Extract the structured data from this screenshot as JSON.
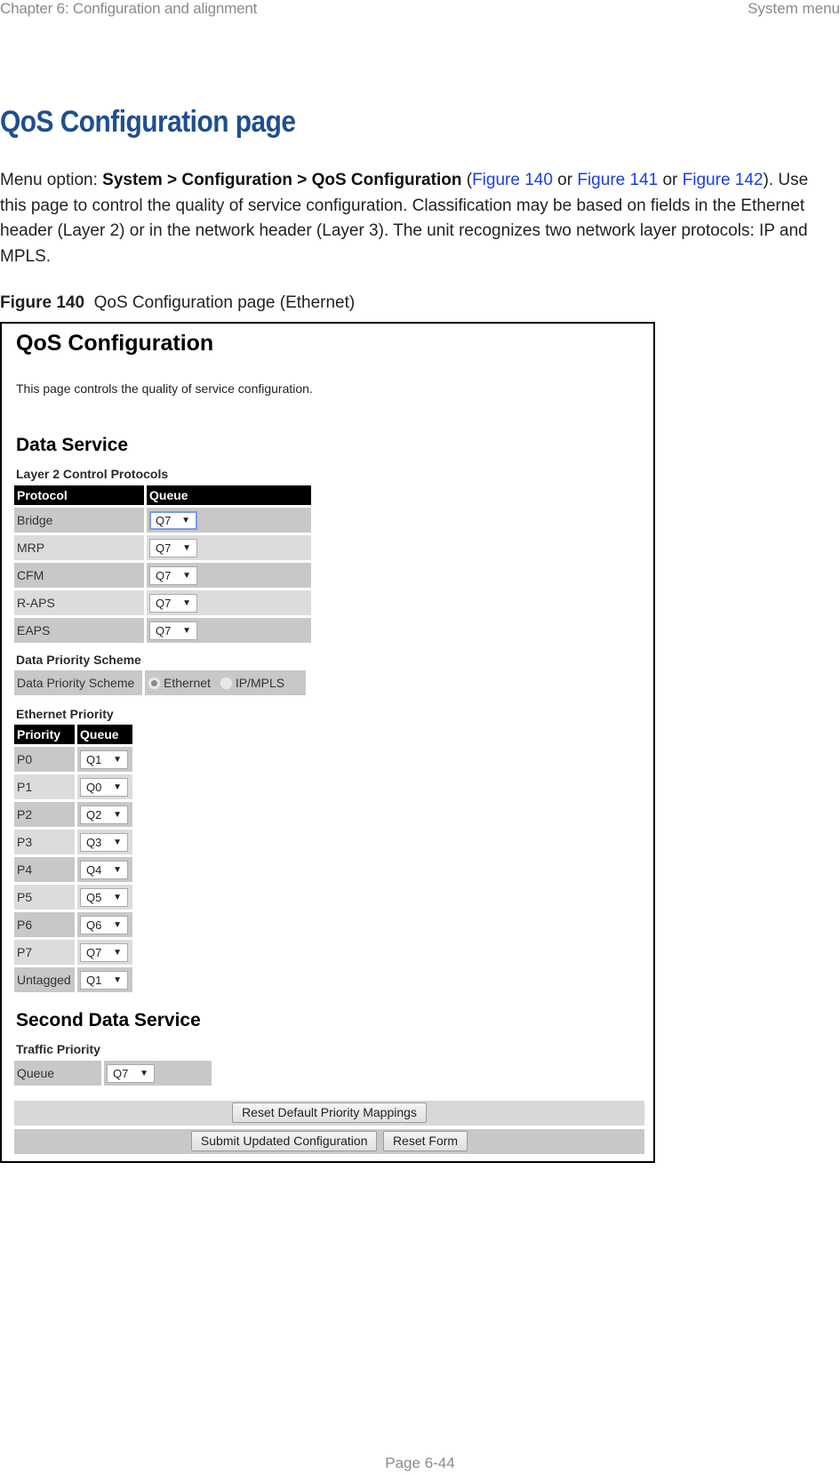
{
  "header": {
    "chapter": "Chapter 6:  Configuration and alignment",
    "section": "System menu"
  },
  "page_title": "QoS Configuration page",
  "intro": {
    "prefix": "Menu option: ",
    "menu_path": "System > Configuration > QoS Configuration",
    "open_paren": " (",
    "link1": "Figure 140",
    "or1": " or ",
    "link2": "Figure 141",
    "or2": " or ",
    "link3": "Figure 142",
    "rest": "). Use this page to control the quality of service configuration. Classification may be based on fields in the Ethernet header (Layer 2) or in the network header (Layer 3). The unit recognizes two network layer protocols: IP and MPLS."
  },
  "caption": {
    "label": "Figure 140",
    "text": "  QoS Configuration page (Ethernet)"
  },
  "figure": {
    "title": "QoS Configuration",
    "description": "This page controls the quality of service configuration.",
    "data_service": {
      "heading": "Data Service",
      "l2_heading": "Layer 2 Control Protocols",
      "l2_columns": [
        "Protocol",
        "Queue"
      ],
      "l2_rows": [
        {
          "protocol": "Bridge",
          "queue": "Q7"
        },
        {
          "protocol": "MRP",
          "queue": "Q7"
        },
        {
          "protocol": "CFM",
          "queue": "Q7"
        },
        {
          "protocol": "R-APS",
          "queue": "Q7"
        },
        {
          "protocol": "EAPS",
          "queue": "Q7"
        }
      ],
      "scheme_heading": "Data Priority Scheme",
      "scheme_label": "Data Priority Scheme",
      "scheme_options": [
        "Ethernet",
        "IP/MPLS"
      ],
      "scheme_selected": "Ethernet",
      "eth_heading": "Ethernet Priority",
      "eth_columns": [
        "Priority",
        "Queue"
      ],
      "eth_rows": [
        {
          "priority": "P0",
          "queue": "Q1"
        },
        {
          "priority": "P1",
          "queue": "Q0"
        },
        {
          "priority": "P2",
          "queue": "Q2"
        },
        {
          "priority": "P3",
          "queue": "Q3"
        },
        {
          "priority": "P4",
          "queue": "Q4"
        },
        {
          "priority": "P5",
          "queue": "Q5"
        },
        {
          "priority": "P6",
          "queue": "Q6"
        },
        {
          "priority": "P7",
          "queue": "Q7"
        },
        {
          "priority": "Untagged",
          "queue": "Q1"
        }
      ]
    },
    "second_service": {
      "heading": "Second Data Service",
      "traffic_heading": "Traffic Priority",
      "queue_label": "Queue",
      "queue_value": "Q7"
    },
    "buttons": {
      "reset_defaults": "Reset Default Priority Mappings",
      "submit": "Submit Updated Configuration",
      "reset_form": "Reset Form"
    },
    "dropdown_arrow": "▼"
  },
  "footer": {
    "page": "Page 6-44"
  }
}
